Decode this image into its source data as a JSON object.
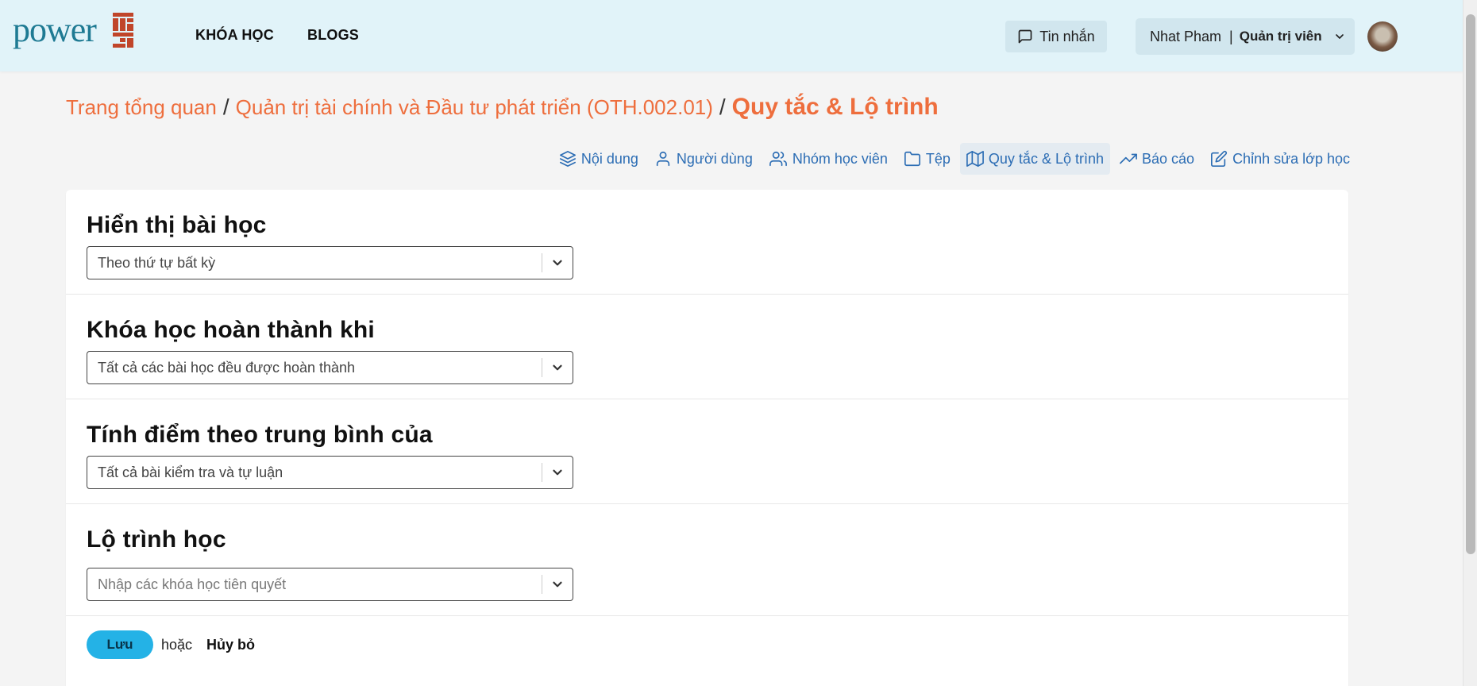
{
  "header": {
    "logo_text": "power",
    "nav": [
      "KHÓA HỌC",
      "BLOGS"
    ],
    "messages_label": "Tin nhắn",
    "user_name": "Nhat Pham",
    "user_separator": "|",
    "user_role": "Quản trị viên"
  },
  "breadcrumb": {
    "items": [
      "Trang tổng quan",
      "Quản trị tài chính và Đầu tư phát triển (OTH.002.01)"
    ],
    "separator": "/",
    "current": "Quy tắc & Lộ trình"
  },
  "tabs": [
    {
      "label": "Nội dung",
      "icon": "layers-icon",
      "active": false
    },
    {
      "label": "Người dùng",
      "icon": "user-icon",
      "active": false
    },
    {
      "label": "Nhóm học viên",
      "icon": "users-icon",
      "active": false
    },
    {
      "label": "Tệp",
      "icon": "folder-icon",
      "active": false
    },
    {
      "label": "Quy tắc & Lộ trình",
      "icon": "map-icon",
      "active": true
    },
    {
      "label": "Báo cáo",
      "icon": "trending-up-icon",
      "active": false
    },
    {
      "label": "Chỉnh sửa lớp học",
      "icon": "edit-icon",
      "active": false
    }
  ],
  "sections": [
    {
      "title": "Hiển thị bài học",
      "value": "Theo thứ tự bất kỳ",
      "placeholder": false
    },
    {
      "title": "Khóa học hoàn thành khi",
      "value": "Tất cả các bài học đều được hoàn thành",
      "placeholder": false
    },
    {
      "title": "Tính điểm theo trung bình của",
      "value": "Tất cả bài kiểm tra và tự luận",
      "placeholder": false
    },
    {
      "title": "Lộ trình học",
      "value": "Nhập các khóa học tiên quyết",
      "placeholder": true
    }
  ],
  "actions": {
    "save_label": "Lưu",
    "or_label": "hoặc",
    "cancel_label": "Hủy bỏ"
  },
  "colors": {
    "header_bg": "#e1f3f9",
    "accent_orange": "#ee6e3d",
    "tab_blue": "#2c6db4",
    "save_button": "#24b2e6",
    "logo_blue": "#1e7a93",
    "logo_mark": "#c0452a"
  }
}
